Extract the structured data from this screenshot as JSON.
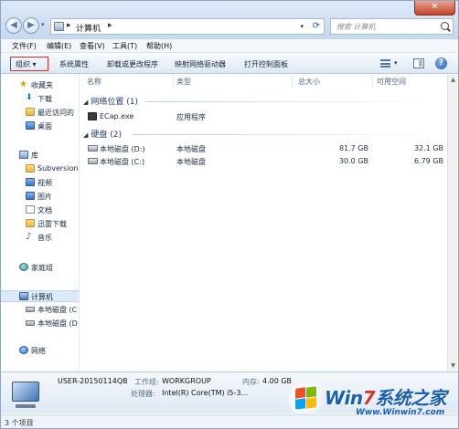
{
  "address": {
    "location": "计算机",
    "search_placeholder": "搜索 计算机"
  },
  "menu": [
    "文件(F)",
    "编辑(E)",
    "查看(V)",
    "工具(T)",
    "帮助(H)"
  ],
  "commands": {
    "organize": "组织 ▾",
    "items": [
      "系统属性",
      "卸载或更改程序",
      "映射网络驱动器",
      "打开控制面板"
    ]
  },
  "nav": {
    "favorites": "收藏夹",
    "favorites_items": [
      "下载",
      "最近访问的",
      "桌面"
    ],
    "library": "库",
    "library_items": [
      "Subversion",
      "视频",
      "图片",
      "文档",
      "迅雷下载",
      "音乐"
    ],
    "homegroup": "家庭组",
    "computer": "计算机",
    "computer_items": [
      "本地磁盘 (C",
      "本地磁盘 (D"
    ],
    "network": "网络"
  },
  "columns": [
    "名称",
    "类型",
    "总大小",
    "可用空间"
  ],
  "groups": [
    {
      "title": "网络位置 (1)",
      "rows": [
        {
          "name": "ECap.exe",
          "type": "应用程序",
          "total": "",
          "free": ""
        }
      ]
    },
    {
      "title": "硬盘 (2)",
      "rows": [
        {
          "name": "本地磁盘 (D:)",
          "type": "本地磁盘",
          "total": "81.7 GB",
          "free": "32.1 GB"
        },
        {
          "name": "本地磁盘 (C:)",
          "type": "本地磁盘",
          "total": "30.0 GB",
          "free": "6.79 GB"
        }
      ]
    }
  ],
  "details": {
    "computer_name": "USER-20150114QB",
    "workgroup_label": "工作组:",
    "workgroup_value": "WORKGROUP",
    "memory_label": "内存:",
    "memory_value": "4.00 GB",
    "cpu_label": "处理器:",
    "cpu_value": "Intel(R) Core(TM) i5-3..."
  },
  "watermark": {
    "brand_a": "Win",
    "brand_b": "7",
    "brand_c": "系统之家",
    "url": "Www.Winwin7.com"
  },
  "status": "3 个项目"
}
